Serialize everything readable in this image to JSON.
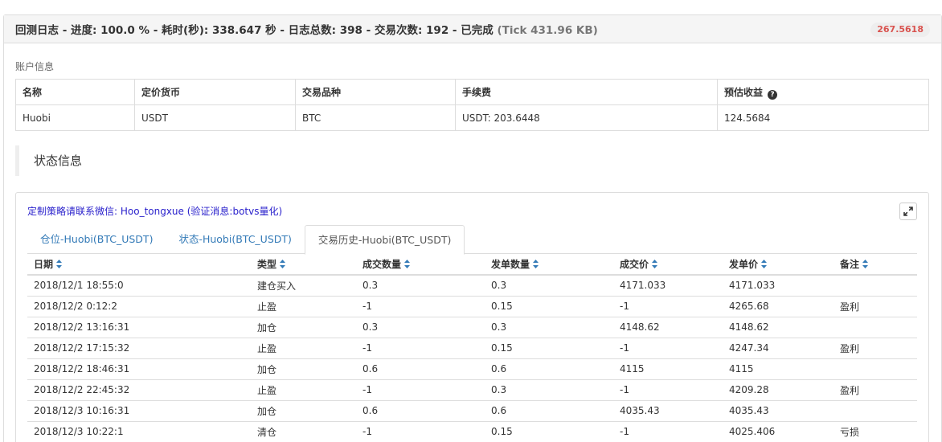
{
  "header": {
    "title": "回测日志 - 进度: 100.0 % - 耗时(秒): 338.647 秒 - 日志总数: 398 - 交易次数: 192 - 已完成",
    "tick": "(Tick 431.96 KB)",
    "score": "267.5618",
    "score_color": "#d9534f"
  },
  "account": {
    "label": "账户信息",
    "columns": [
      "名称",
      "定价货币",
      "交易品种",
      "手续费",
      "预估收益"
    ],
    "row": [
      "Huobi",
      "USDT",
      "BTC",
      "USDT: 203.6448",
      "124.5684"
    ],
    "help_glyph": "?"
  },
  "status": {
    "label": "状态信息"
  },
  "promo": "定制策略请联系微信: Hoo_tongxue (验证消息:botvs量化)",
  "tabs": [
    {
      "label": "仓位-Huobi(BTC_USDT)",
      "active": false
    },
    {
      "label": "状态-Huobi(BTC_USDT)",
      "active": false
    },
    {
      "label": "交易历史-Huobi(BTC_USDT)",
      "active": true
    }
  ],
  "trades": {
    "columns": [
      "日期",
      "类型",
      "成交数量",
      "发单数量",
      "成交价",
      "发单价",
      "备注"
    ],
    "rows": [
      [
        "2018/12/1 18:55:0",
        "建仓买入",
        "0.3",
        "0.3",
        "4171.033",
        "4171.033",
        ""
      ],
      [
        "2018/12/2 0:12:2",
        "止盈",
        "-1",
        "0.15",
        "-1",
        "4265.68",
        "盈利"
      ],
      [
        "2018/12/2 13:16:31",
        "加仓",
        "0.3",
        "0.3",
        "4148.62",
        "4148.62",
        ""
      ],
      [
        "2018/12/2 17:15:32",
        "止盈",
        "-1",
        "0.15",
        "-1",
        "4247.34",
        "盈利"
      ],
      [
        "2018/12/2 18:46:31",
        "加仓",
        "0.6",
        "0.6",
        "4115",
        "4115",
        ""
      ],
      [
        "2018/12/2 22:45:32",
        "止盈",
        "-1",
        "0.3",
        "-1",
        "4209.28",
        "盈利"
      ],
      [
        "2018/12/3 10:16:31",
        "加仓",
        "0.6",
        "0.6",
        "4035.43",
        "4035.43",
        ""
      ],
      [
        "2018/12/3 10:22:1",
        "清仓",
        "-1",
        "0.15",
        "-1",
        "4025.406",
        "亏损"
      ]
    ]
  },
  "colors": {
    "link": "#337ab7",
    "sort_icon": "#337ab7"
  },
  "icons": {
    "expand": "expand-icon",
    "sort": "sort-icon",
    "help": "question-circle-icon"
  }
}
